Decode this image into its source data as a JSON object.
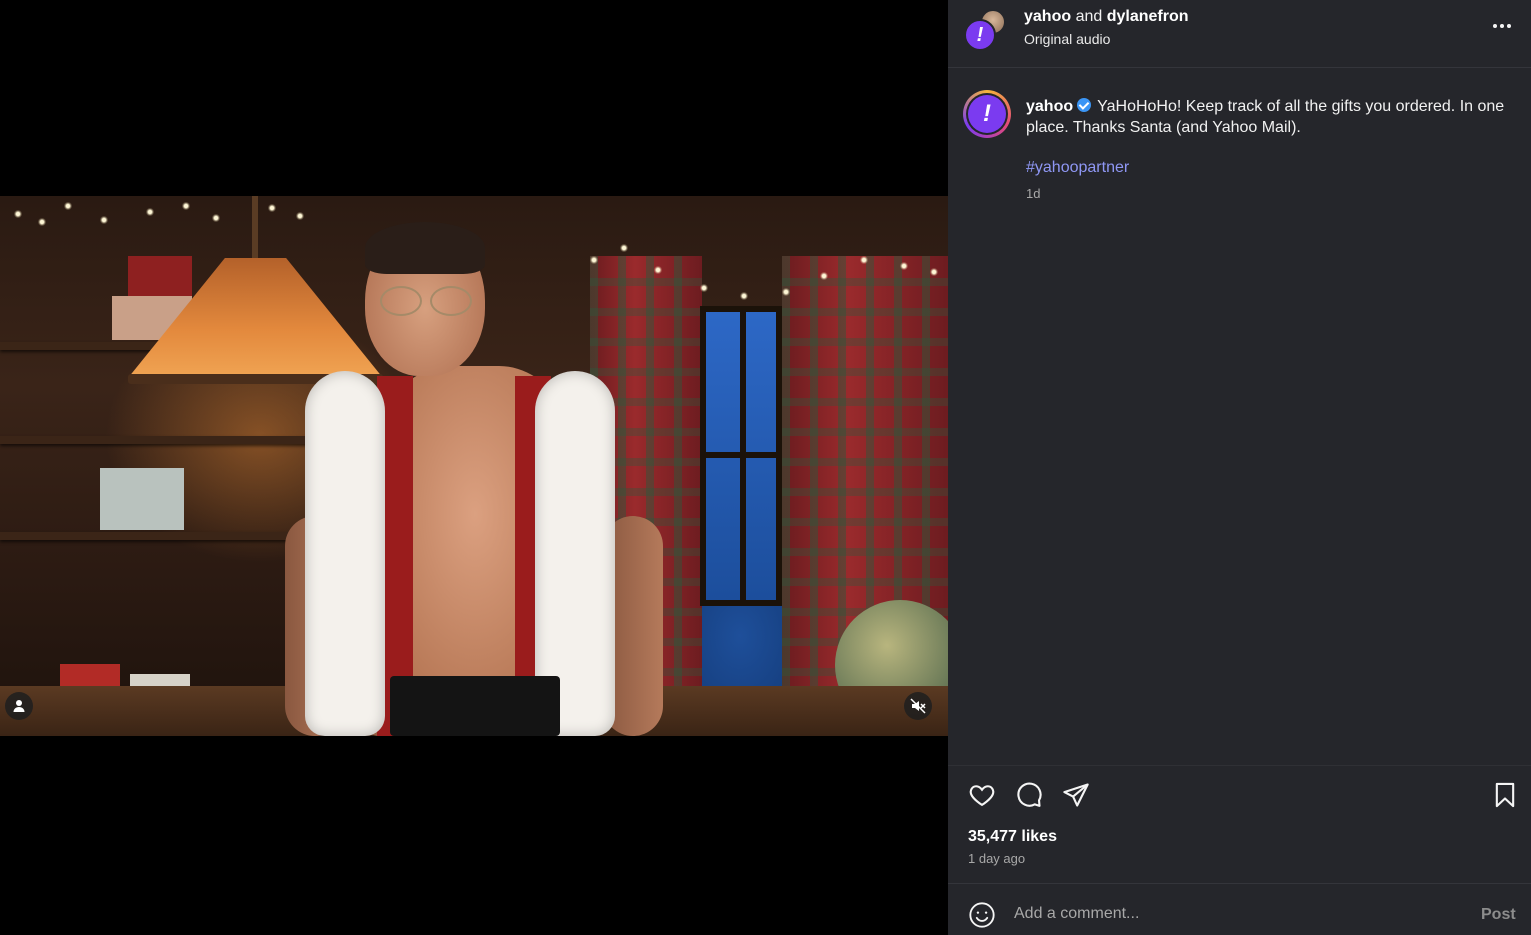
{
  "header": {
    "author_primary": "yahoo",
    "conjunction": "and",
    "author_secondary": "dylanefron",
    "audio_label": "Original audio",
    "more_icon": "more-horizontal-icon"
  },
  "caption": {
    "username": "yahoo",
    "verified_icon": "verified-badge-icon",
    "text": "YaHoHoHo! Keep track of all the gifts you ordered. In one place. Thanks Santa (and Yahoo Mail).",
    "hashtag": "#yahoopartner",
    "age": "1d"
  },
  "video": {
    "tag_icon": "user-tag-icon",
    "mute_icon": "muted-speaker-icon"
  },
  "actions": {
    "like_icon": "heart-icon",
    "comment_icon": "comment-bubble-icon",
    "share_icon": "paper-plane-icon",
    "save_icon": "bookmark-icon",
    "likes": "35,477 likes",
    "posted": "1 day ago"
  },
  "comment": {
    "emoji_icon": "emoji-smile-icon",
    "placeholder": "Add a comment...",
    "post_label": "Post"
  },
  "colors": {
    "panel_bg": "#25262b",
    "accent_purple": "#7b3bf0",
    "hashtag": "#8f97f4",
    "verified": "#3b95f5"
  }
}
